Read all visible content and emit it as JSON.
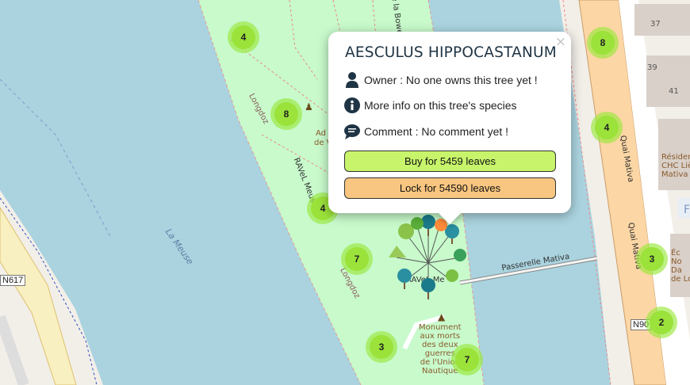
{
  "map": {
    "labels": {
      "river": "La Meuse",
      "ravel": "RAVeL Meuse",
      "longdoz_1": "Longdoz",
      "longdoz_2": "Longdoz",
      "quai_1": "Quai Mativa",
      "quai_2": "Quai Mativa",
      "passerelle": "Passerelle Mativa",
      "bowerie": "e la Bowe",
      "n617": "N617",
      "n90": "N90",
      "admin_1": "Ad",
      "admin_2": "de V",
      "house_37": "37",
      "house_39": "39",
      "house_41": "41",
      "residence": [
        "Résiden",
        "CHC Liè",
        "Mativa"
      ],
      "ecole": [
        "Éc",
        "No",
        "Da",
        "de Lo"
      ],
      "f_label": "F",
      "ravel_mark": "RAVeL Me",
      "monument": [
        "Monument",
        "aux morts",
        "des deux",
        "guerres",
        "de l'Union",
        "Nautique"
      ]
    },
    "clusters": [
      {
        "id": "c1",
        "count": "4"
      },
      {
        "id": "c2",
        "count": "8"
      },
      {
        "id": "c3",
        "count": "4"
      },
      {
        "id": "c4",
        "count": "7"
      },
      {
        "id": "c5",
        "count": "3"
      },
      {
        "id": "c6",
        "count": "7"
      },
      {
        "id": "c7",
        "count": "8"
      },
      {
        "id": "c8",
        "count": "4"
      },
      {
        "id": "c9",
        "count": "3"
      },
      {
        "id": "c10",
        "count": "2"
      }
    ]
  },
  "popup": {
    "title": "AESCULUS HIPPOCASTANUM",
    "close_label": "×",
    "owner": "Owner : No one owns this tree yet !",
    "more_info": "More info on this tree's species",
    "comment": "Comment : No comment yet !",
    "buy_label": "Buy for 5459 leaves",
    "lock_label": "Lock for 54590 leaves"
  },
  "colors": {
    "water": "#aad3df",
    "park": "#c8facc",
    "road_primary": "#fcd6a4",
    "cluster": "#9be23a",
    "buy": "#c7f46b",
    "lock": "#f8c680"
  }
}
